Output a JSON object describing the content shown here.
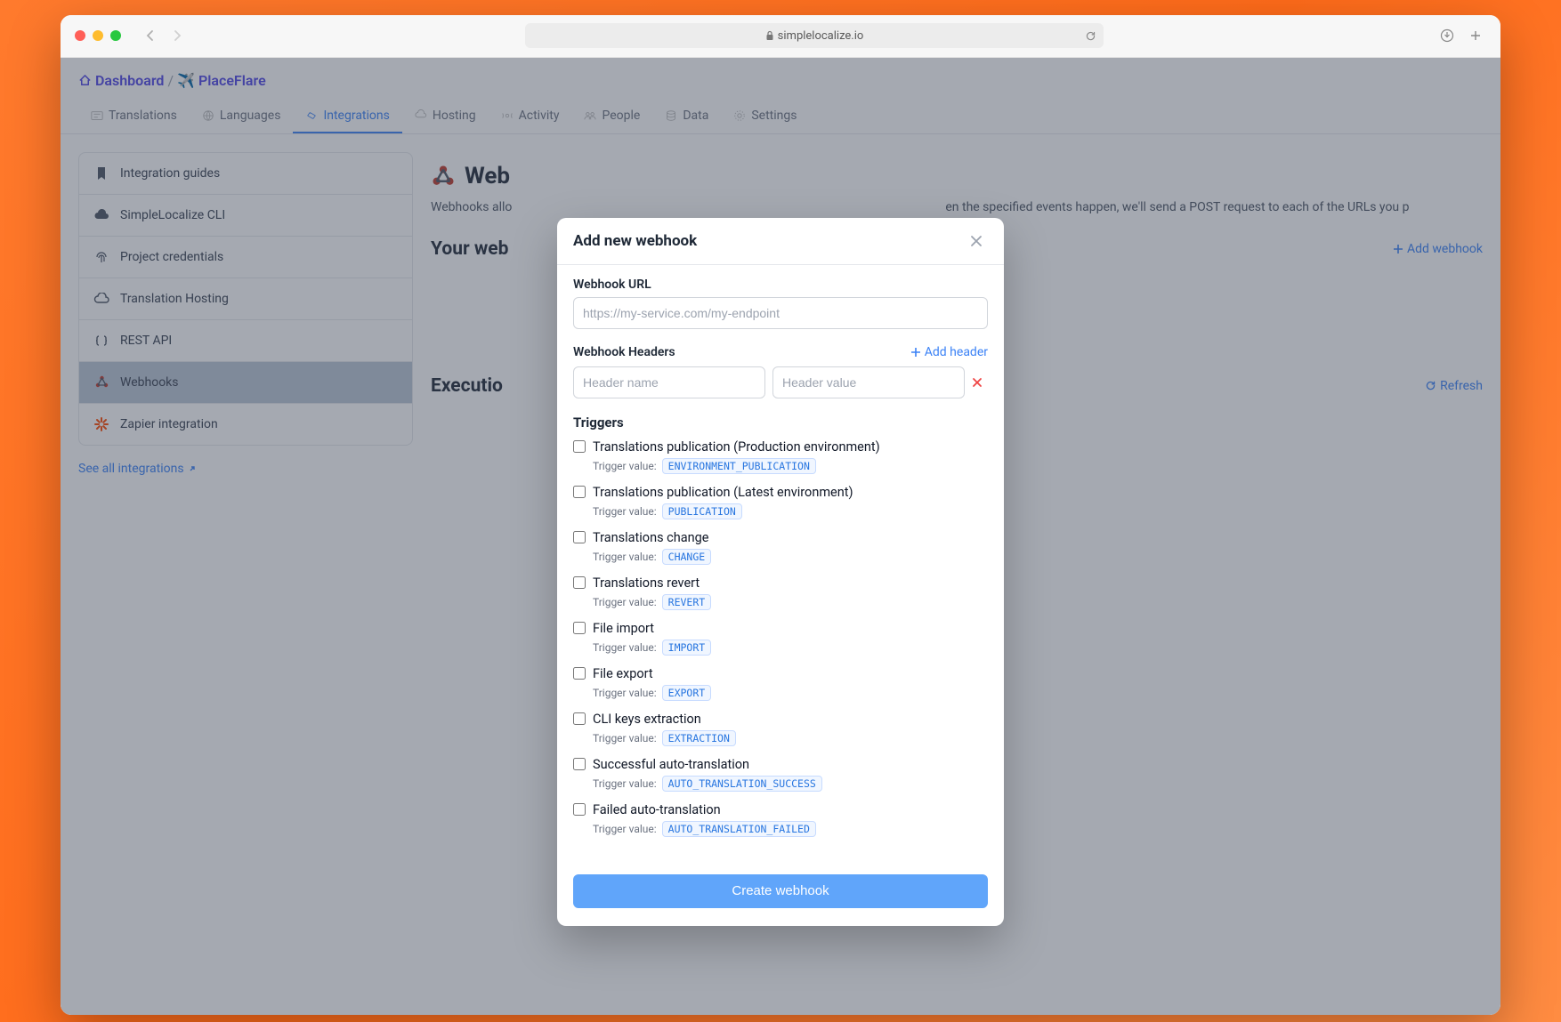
{
  "browser": {
    "url_host": "simplelocalize.io"
  },
  "breadcrumb": {
    "dashboard": "Dashboard",
    "project": "PlaceFlare"
  },
  "tabs": [
    {
      "label": "Translations"
    },
    {
      "label": "Languages"
    },
    {
      "label": "Integrations"
    },
    {
      "label": "Hosting"
    },
    {
      "label": "Activity"
    },
    {
      "label": "People"
    },
    {
      "label": "Data"
    },
    {
      "label": "Settings"
    }
  ],
  "sidebar": {
    "items": [
      {
        "label": "Integration guides"
      },
      {
        "label": "SimpleLocalize CLI"
      },
      {
        "label": "Project credentials"
      },
      {
        "label": "Translation Hosting"
      },
      {
        "label": "REST API"
      },
      {
        "label": "Webhooks"
      },
      {
        "label": "Zapier integration"
      }
    ],
    "see_all": "See all integrations"
  },
  "page": {
    "title": "Webhooks",
    "desc_prefix": "Webhooks allo",
    "desc_suffix": "en the specified events happen, we'll send a POST request to each of the URLs you p",
    "your_webhooks": "Your web",
    "add_webhook": "Add webhook",
    "execution_log": "Executio",
    "refresh": "Refresh"
  },
  "modal": {
    "title": "Add new webhook",
    "url_label": "Webhook URL",
    "url_placeholder": "https://my-service.com/my-endpoint",
    "headers_label": "Webhook Headers",
    "add_header": "Add header",
    "header_name_placeholder": "Header name",
    "header_value_placeholder": "Header value",
    "triggers_label": "Triggers",
    "trigger_value_label": "Trigger value:",
    "triggers": [
      {
        "name": "Translations publication (Production environment)",
        "value": "ENVIRONMENT_PUBLICATION"
      },
      {
        "name": "Translations publication (Latest environment)",
        "value": "PUBLICATION"
      },
      {
        "name": "Translations change",
        "value": "CHANGE"
      },
      {
        "name": "Translations revert",
        "value": "REVERT"
      },
      {
        "name": "File import",
        "value": "IMPORT"
      },
      {
        "name": "File export",
        "value": "EXPORT"
      },
      {
        "name": "CLI keys extraction",
        "value": "EXTRACTION"
      },
      {
        "name": "Successful auto-translation",
        "value": "AUTO_TRANSLATION_SUCCESS"
      },
      {
        "name": "Failed auto-translation",
        "value": "AUTO_TRANSLATION_FAILED"
      }
    ],
    "create_button": "Create webhook"
  }
}
